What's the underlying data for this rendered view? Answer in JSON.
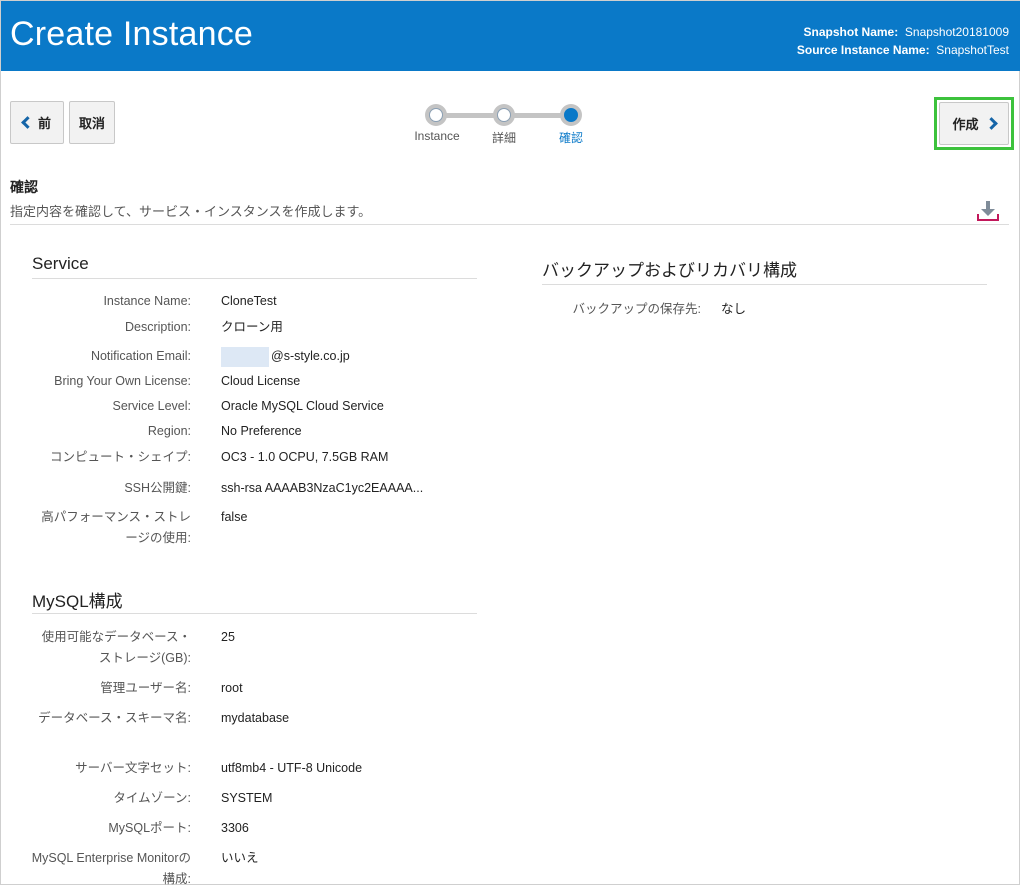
{
  "header": {
    "title": "Create Instance",
    "snapshot_name_label": "Snapshot Name:",
    "snapshot_name_value": "Snapshot20181009",
    "source_instance_label": "Source Instance Name:",
    "source_instance_value": "SnapshotTest"
  },
  "nav": {
    "back_label": "前",
    "cancel_label": "取消",
    "create_label": "作成",
    "steps": [
      {
        "label": "Instance",
        "state": "done"
      },
      {
        "label": "詳細",
        "state": "done"
      },
      {
        "label": "確認",
        "state": "current"
      }
    ]
  },
  "confirm": {
    "title": "確認",
    "description": "指定内容を確認して、サービス・インスタンスを作成します。",
    "download_icon": "download-icon"
  },
  "service": {
    "title": "Service",
    "rows": [
      {
        "key": "Instance Name:",
        "value": "CloneTest"
      },
      {
        "key": "Description:",
        "value": "クローン用"
      },
      {
        "key": "Notification Email:",
        "value": "@s-style.co.jp"
      },
      {
        "key": "Bring Your Own License:",
        "value": "Cloud License"
      },
      {
        "key": "Service Level:",
        "value": "Oracle MySQL Cloud Service"
      },
      {
        "key": "Region:",
        "value": "No Preference"
      },
      {
        "key": "コンピュート・シェイプ:",
        "value": "OC3 - 1.0 OCPU, 7.5GB RAM"
      },
      {
        "key": "SSH公開鍵:",
        "value": "ssh-rsa AAAAB3NzaC1yc2EAAAA..."
      },
      {
        "key": "高パフォーマンス・ストレージの使用:",
        "value": "false"
      }
    ]
  },
  "mysql": {
    "title": "MySQL構成",
    "rows": [
      {
        "key": "使用可能なデータベース・ストレージ(GB):",
        "value": "25"
      },
      {
        "key": "管理ユーザー名:",
        "value": "root"
      },
      {
        "key": "データベース・スキーマ名:",
        "value": "mydatabase"
      },
      {
        "key": "サーバー文字セット:",
        "value": "utf8mb4 - UTF-8 Unicode"
      },
      {
        "key": "タイムゾーン:",
        "value": "SYSTEM"
      },
      {
        "key": "MySQLポート:",
        "value": "3306"
      },
      {
        "key": "MySQL Enterprise Monitorの構成:",
        "value": "いいえ"
      }
    ]
  },
  "backup": {
    "title": "バックアップおよびリカバリ構成",
    "rows": [
      {
        "key": "バックアップの保存先:",
        "value": "なし"
      }
    ]
  }
}
